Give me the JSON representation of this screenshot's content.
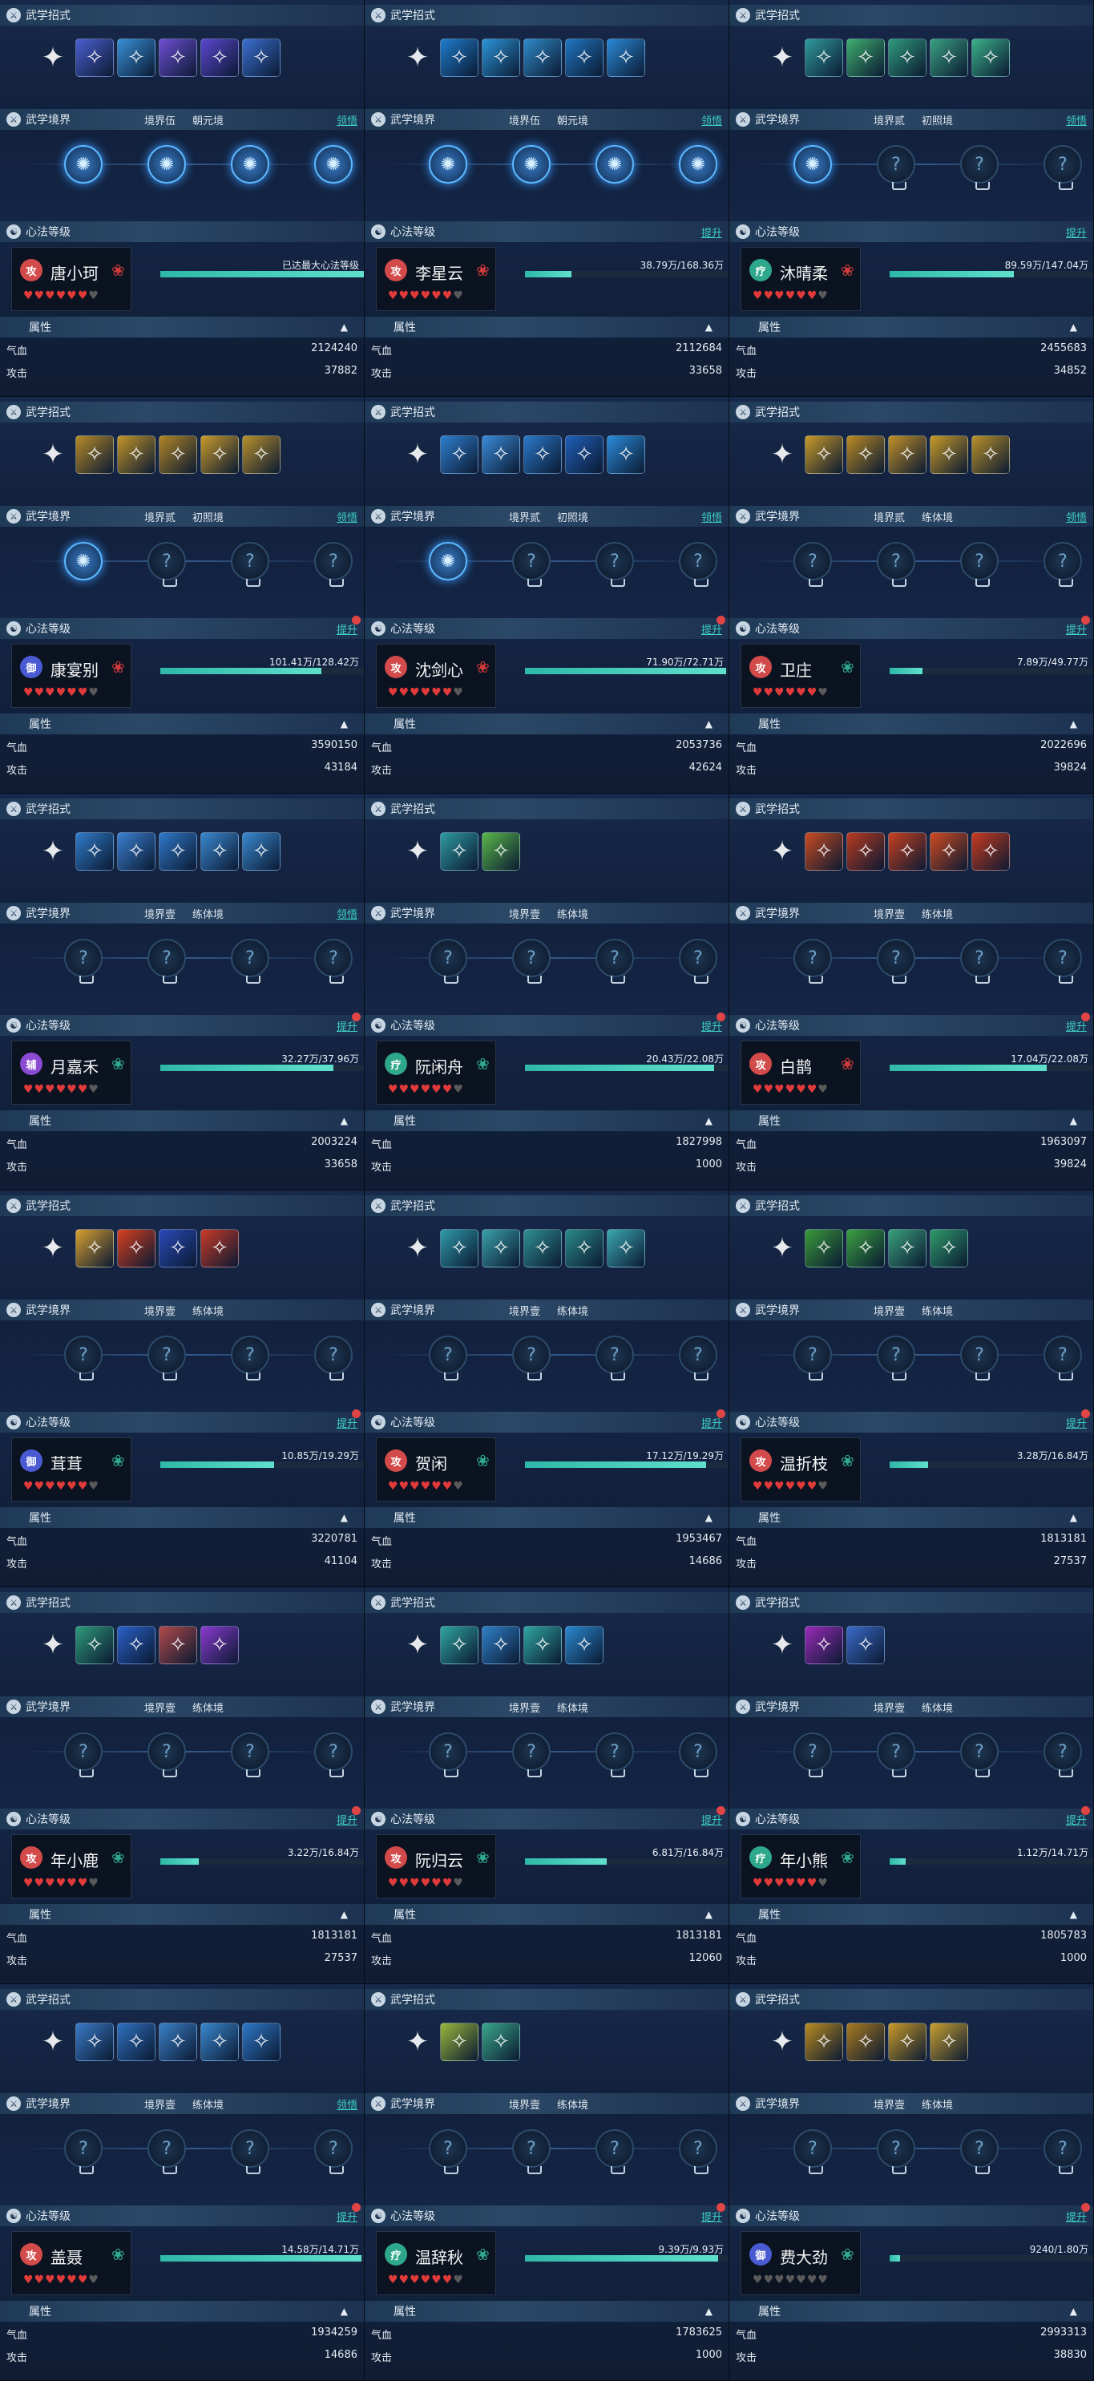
{
  "labels": {
    "skills": "武学招式",
    "realm": "武学境界",
    "xinfa": "心法等级",
    "attr": "属性",
    "hp": "气血",
    "atk": "攻击",
    "lingwu": "领悟",
    "tisheng": "提升"
  },
  "cards": [
    {
      "name": "唐小珂",
      "cls": "攻",
      "clsColor": "#d24a4a",
      "pet": "red",
      "hearts": 6,
      "realm1": "境界伍",
      "realm2": "朝元境",
      "lingwu": true,
      "xinfaBtn": false,
      "dot": false,
      "xval": "已达最大心法等级",
      "fill": 1.0,
      "hp": "2124240",
      "atk": "37882",
      "skillCols": [
        "#3a7fd9",
        "#4b5fd0",
        "#3890d6",
        "#6d4ed3",
        "#5b46d0",
        "#3a6fd0"
      ],
      "litNodes": 4
    },
    {
      "name": "李星云",
      "cls": "攻",
      "clsColor": "#d24a4a",
      "pet": "red",
      "hearts": 6,
      "realm1": "境界伍",
      "realm2": "朝元境",
      "lingwu": true,
      "xinfaBtn": true,
      "dot": false,
      "xval": "38.79万/168.36万",
      "fill": 0.23,
      "hp": "2112684",
      "atk": "33658",
      "skillCols": [
        "#1f4fa6",
        "#1e7ccc",
        "#2b95d8",
        "#2f8ac8",
        "#2075c0",
        "#2a88d6"
      ],
      "litNodes": 4
    },
    {
      "name": "沐晴柔",
      "cls": "疗",
      "clsColor": "#2ea88a",
      "pet": "red",
      "hearts": 6,
      "realm1": "境界贰",
      "realm2": "初照境",
      "lingwu": true,
      "xinfaBtn": true,
      "dot": false,
      "xval": "89.59万/147.04万",
      "fill": 0.61,
      "hp": "2455683",
      "atk": "34852",
      "skillCols": [
        "#b04ad0",
        "#2f9a9a",
        "#3fae6f",
        "#2f9a7a",
        "#3aa080",
        "#3bb088"
      ],
      "litNodes": 1
    },
    {
      "name": "康宴别",
      "cls": "御",
      "clsColor": "#4a5ad2",
      "pet": "red",
      "hearts": 6,
      "realm1": "境界贰",
      "realm2": "初照境",
      "lingwu": true,
      "xinfaBtn": true,
      "dot": true,
      "xval": "101.41万/128.42万",
      "fill": 0.79,
      "hp": "3590150",
      "atk": "43184",
      "skillCols": [
        "#d0a020",
        "#b58a28",
        "#c29428",
        "#b08524",
        "#c89a2a",
        "#b8902a"
      ],
      "litNodes": 1
    },
    {
      "name": "沈剑心",
      "cls": "攻",
      "clsColor": "#d24a4a",
      "pet": "red",
      "hearts": 6,
      "realm1": "境界贰",
      "realm2": "初照境",
      "lingwu": true,
      "xinfaBtn": true,
      "dot": true,
      "xval": "71.90万/72.71万",
      "fill": 0.99,
      "hp": "2053736",
      "atk": "42624",
      "skillCols": [
        "#2f86d6",
        "#2f7fd0",
        "#3a8ad8",
        "#2a78c8",
        "#1f5fb8",
        "#2a8ad8"
      ],
      "litNodes": 1
    },
    {
      "name": "卫庄",
      "cls": "攻",
      "clsColor": "#d24a4a",
      "pet": "teal",
      "hearts": 6,
      "realm1": "境界贰",
      "realm2": "练体境",
      "lingwu": true,
      "xinfaBtn": true,
      "dot": true,
      "xval": "7.89万/49.77万",
      "fill": 0.16,
      "hp": "2022696",
      "atk": "39824",
      "skillCols": [
        "#c89a28",
        "#c89a28",
        "#b88a24",
        "#c09028",
        "#c89a28",
        "#b89028"
      ],
      "litNodes": 0
    },
    {
      "name": "月嘉禾",
      "cls": "辅",
      "clsColor": "#8a4ad2",
      "pet": "teal",
      "hearts": 6,
      "realm1": "境界壹",
      "realm2": "练体境",
      "lingwu": true,
      "xinfaBtn": true,
      "dot": true,
      "xval": "32.27万/37.96万",
      "fill": 0.85,
      "hp": "2003224",
      "atk": "33658",
      "skillCols": [
        "#2f6fc8",
        "#2f7ac8",
        "#3a80d0",
        "#2f78c8",
        "#3a88d0",
        "#3a88d0"
      ],
      "litNodes": 0
    },
    {
      "name": "阮闲舟",
      "cls": "疗",
      "clsColor": "#2ea88a",
      "pet": "teal",
      "hearts": 6,
      "realm1": "境界壹",
      "realm2": "练体境",
      "lingwu": false,
      "xinfaBtn": true,
      "dot": true,
      "xval": "20.43万/22.08万",
      "fill": 0.93,
      "hp": "1827998",
      "atk": "1000",
      "skillCols": [
        "#2fa6a0",
        "#2f9aa0",
        "#5ab84a"
      ],
      "litNodes": 0
    },
    {
      "name": "白鹊",
      "cls": "攻",
      "clsColor": "#d24a4a",
      "pet": "red",
      "hearts": 6,
      "realm1": "境界壹",
      "realm2": "练体境",
      "lingwu": false,
      "xinfaBtn": true,
      "dot": true,
      "xval": "17.04万/22.08万",
      "fill": 0.77,
      "hp": "1963097",
      "atk": "39824",
      "skillCols": [
        "#d23a20",
        "#c84a20",
        "#b83a20",
        "#c84020",
        "#d04a20",
        "#c83a20"
      ],
      "litNodes": 0
    },
    {
      "name": "茸茸",
      "cls": "御",
      "clsColor": "#4a5ad2",
      "pet": "teal",
      "hearts": 6,
      "realm1": "境界壹",
      "realm2": "练体境",
      "lingwu": false,
      "xinfaBtn": true,
      "dot": true,
      "xval": "10.85万/19.29万",
      "fill": 0.56,
      "hp": "3220781",
      "atk": "41104",
      "skillCols": [
        "#d86a20",
        "#d8a030",
        "#d84020",
        "#2a4ab8",
        "#c83a28"
      ],
      "litNodes": 0
    },
    {
      "name": "贺闲",
      "cls": "攻",
      "clsColor": "#d24a4a",
      "pet": "teal",
      "hearts": 6,
      "realm1": "境界壹",
      "realm2": "练体境",
      "lingwu": false,
      "xinfaBtn": true,
      "dot": true,
      "xval": "17.12万/19.29万",
      "fill": 0.89,
      "hp": "1953467",
      "atk": "14686",
      "skillCols": [
        "#2fa6b0",
        "#2f9aa8",
        "#3aa0a8",
        "#2f9090",
        "#2a8a88",
        "#3aa8b0"
      ],
      "litNodes": 0
    },
    {
      "name": "温折枝",
      "cls": "攻",
      "clsColor": "#d24a4a",
      "pet": "teal",
      "hearts": 6,
      "realm1": "境界壹",
      "realm2": "练体境",
      "lingwu": false,
      "xinfaBtn": true,
      "dot": true,
      "xval": "3.28万/16.84万",
      "fill": 0.19,
      "hp": "1813181",
      "atk": "27537",
      "skillCols": [
        "#2fa67a",
        "#3a9a3a",
        "#3aa040",
        "#3aa07a",
        "#2f9a6a"
      ],
      "litNodes": 0
    },
    {
      "name": "年小鹿",
      "cls": "攻",
      "clsColor": "#d24a4a",
      "pet": "teal",
      "hearts": 6,
      "realm1": "境界壹",
      "realm2": "练体境",
      "lingwu": false,
      "xinfaBtn": true,
      "dot": true,
      "xval": "3.22万/16.84万",
      "fill": 0.19,
      "hp": "1813181",
      "atk": "27537",
      "skillCols": [
        "#b83ad0",
        "#2f9a7a",
        "#2a60c8",
        "#b04a4a",
        "#8a3ad0"
      ],
      "litNodes": 0
    },
    {
      "name": "阮归云",
      "cls": "攻",
      "clsColor": "#d24a4a",
      "pet": "teal",
      "hearts": 6,
      "realm1": "境界壹",
      "realm2": "练体境",
      "lingwu": false,
      "xinfaBtn": true,
      "dot": true,
      "xval": "6.81万/16.84万",
      "fill": 0.4,
      "hp": "1813181",
      "atk": "12060",
      "skillCols": [
        "#2f6fc8",
        "#2fa6a0",
        "#2f80c8",
        "#2fa6a0",
        "#2a88d0"
      ],
      "litNodes": 0
    },
    {
      "name": "年小熊",
      "cls": "疗",
      "clsColor": "#2ea88a",
      "pet": "teal",
      "hearts": 6,
      "realm1": "境界壹",
      "realm2": "练体境",
      "lingwu": false,
      "xinfaBtn": true,
      "dot": true,
      "xval": "1.12万/14.71万",
      "fill": 0.08,
      "hp": "1805783",
      "atk": "1000",
      "skillCols": [
        "#a83ad0",
        "#9a2ab8",
        "#3a6ac8"
      ],
      "litNodes": 0
    },
    {
      "name": "盖聂",
      "cls": "攻",
      "clsColor": "#d24a4a",
      "pet": "teal",
      "hearts": 6,
      "realm1": "境界壹",
      "realm2": "练体境",
      "lingwu": true,
      "xinfaBtn": true,
      "dot": true,
      "xval": "14.58万/14.71万",
      "fill": 0.99,
      "hp": "1934259",
      "atk": "14686",
      "skillCols": [
        "#2f6fc8",
        "#3a7ac8",
        "#2f70c0",
        "#3a80c8",
        "#3a88d0",
        "#2f78c8"
      ],
      "litNodes": 0
    },
    {
      "name": "温辞秋",
      "cls": "疗",
      "clsColor": "#2ea88a",
      "pet": "teal",
      "hearts": 6,
      "realm1": "境界壹",
      "realm2": "练体境",
      "lingwu": false,
      "xinfaBtn": true,
      "dot": true,
      "xval": "9.39万/9.93万",
      "fill": 0.95,
      "hp": "1783625",
      "atk": "1000",
      "skillCols": [
        "#b03ad0",
        "#9ab83a",
        "#3aa88a"
      ],
      "litNodes": 0
    },
    {
      "name": "费大劲",
      "cls": "御",
      "clsColor": "#4a5ad2",
      "pet": "teal",
      "hearts": 0,
      "realm1": "境界壹",
      "realm2": "练体境",
      "lingwu": false,
      "xinfaBtn": true,
      "dot": true,
      "xval": "9240/1.80万",
      "fill": 0.05,
      "hp": "2993313",
      "atk": "38830",
      "skillCols": [
        "#c89a28",
        "#b88a20",
        "#a87a20",
        "#c89a28",
        "#c8a030"
      ],
      "litNodes": 0
    }
  ]
}
